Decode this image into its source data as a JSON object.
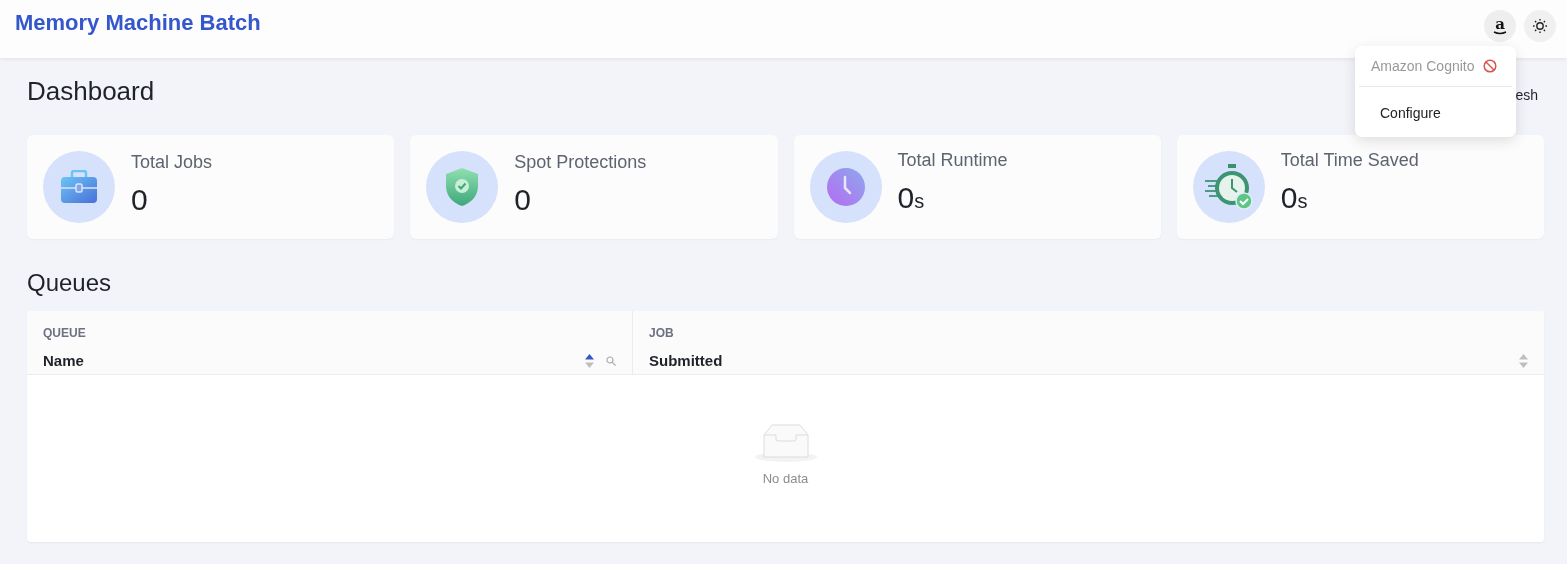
{
  "header": {
    "title": "Memory Machine Batch",
    "auth_button": {
      "label": "a"
    }
  },
  "auth_menu": {
    "provider": "Amazon Cognito",
    "provider_disabled": true,
    "items": [
      "Configure"
    ]
  },
  "dashboard": {
    "title": "Dashboard",
    "refresh_label": "esh",
    "stats": [
      {
        "kind": "briefcase",
        "label": "Total Jobs",
        "value": "0"
      },
      {
        "kind": "shield",
        "label": "Spot Protections",
        "value": "0"
      },
      {
        "kind": "clock",
        "label": "Total Runtime",
        "value": "0",
        "unit": "s"
      },
      {
        "kind": "stopwatch",
        "label": "Total Time Saved",
        "value": "0",
        "unit": "s"
      }
    ]
  },
  "queues": {
    "title": "Queues",
    "columns": [
      {
        "group": "QUEUE",
        "label": "Name",
        "sort_active": true,
        "searchable": true
      },
      {
        "group": "JOB",
        "label": "Submitted",
        "sort_active": false,
        "searchable": false
      }
    ],
    "empty_text": "No data"
  }
}
